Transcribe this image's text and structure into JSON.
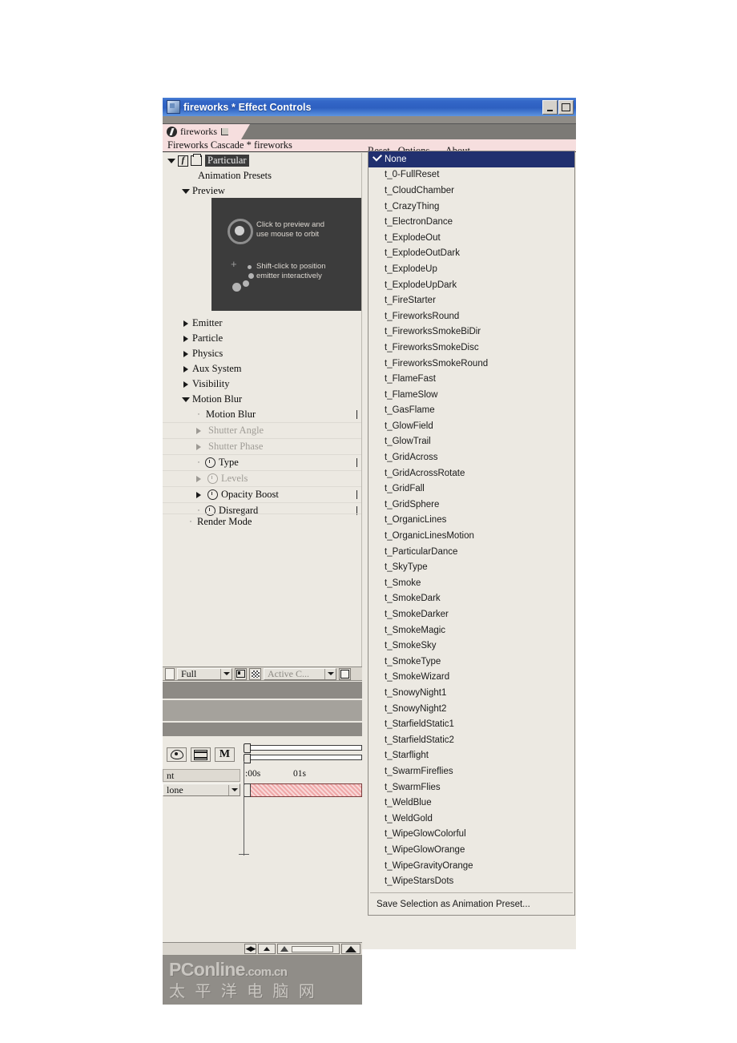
{
  "window": {
    "title": "fireworks * Effect Controls",
    "icon": "composition-icon",
    "minimize_label": "Minimize",
    "maximize_label": "Maximize"
  },
  "tab": {
    "label": "fireworks",
    "icon": "comp-tab-icon",
    "menu_glyph": "panel-menu-icon"
  },
  "comp_header": {
    "text": "Fireworks Cascade * fireworks"
  },
  "effect": {
    "name": "Particular",
    "fx_badge": "fx",
    "cube_icon": "effect-cube-icon",
    "animation_presets_label": "Animation Presets",
    "preview_label": "Preview",
    "preview_box": {
      "line1": "Click to preview and\nuse mouse to orbit",
      "line2": "Shift-click to position\nemitter interactively"
    },
    "groups": [
      {
        "label": "Emitter",
        "state": "closed",
        "indent": 1,
        "disabled": false
      },
      {
        "label": "Particle",
        "state": "closed",
        "indent": 1,
        "disabled": false
      },
      {
        "label": "Physics",
        "state": "closed",
        "indent": 1,
        "disabled": false
      },
      {
        "label": "Aux System",
        "state": "closed",
        "indent": 1,
        "disabled": false
      },
      {
        "label": "Visibility",
        "state": "closed",
        "indent": 1,
        "disabled": false
      },
      {
        "label": "Motion Blur",
        "state": "open",
        "indent": 1,
        "disabled": false
      }
    ],
    "motion_blur_children": [
      {
        "label": "Motion Blur",
        "state": "none",
        "disabled": false,
        "stopwatch": false
      },
      {
        "label": "Shutter Angle",
        "state": "closed",
        "disabled": true,
        "stopwatch": false
      },
      {
        "label": "Shutter Phase",
        "state": "closed",
        "disabled": true,
        "stopwatch": false
      },
      {
        "label": "Type",
        "state": "none",
        "disabled": false,
        "stopwatch": true
      },
      {
        "label": "Levels",
        "state": "closed",
        "disabled": true,
        "stopwatch": true
      },
      {
        "label": "Opacity Boost",
        "state": "closed",
        "disabled": false,
        "stopwatch": true
      },
      {
        "label": "Disregard",
        "state": "none",
        "disabled": false,
        "stopwatch": true
      }
    ],
    "render_mode_label": "Render Mode"
  },
  "ec_toolbar": {
    "quality_value": "Full",
    "toggle_alpha_icon": "region-of-interest-icon",
    "transparency_grid_icon": "transparency-grid-icon",
    "view_value": "Active C...",
    "fullscreen_icon": "full-screen-icon"
  },
  "timeline": {
    "switch_video": "video-switch-icon",
    "switch_frame_blend": "frame-blend-icon",
    "switch_motion_blur": "M",
    "label_value": "nt",
    "parent_value": "lone",
    "ruler": [
      {
        "text": ":00s",
        "x": 2
      },
      {
        "text": "01s",
        "x": 62
      }
    ],
    "clip_color": "#efa8a8"
  },
  "footer": {
    "buttons": [
      "pan-behind-icon",
      "zoom-out-icon",
      "zoom-slider",
      "zoom-in-icon"
    ]
  },
  "watermark": {
    "line1_main": "PConline",
    "line1_suffix": ".com.cn",
    "line2": "太 平 洋 电 脑 网"
  },
  "menu": {
    "commands": [
      "Reset",
      "Options...",
      "About..."
    ],
    "selected_item": "None",
    "items": [
      "t_0-FullReset",
      "t_CloudChamber",
      "t_CrazyThing",
      "t_ElectronDance",
      "t_ExplodeOut",
      "t_ExplodeOutDark",
      "t_ExplodeUp",
      "t_ExplodeUpDark",
      "t_FireStarter",
      "t_FireworksRound",
      "t_FireworksSmokeBiDir",
      "t_FireworksSmokeDisc",
      "t_FireworksSmokeRound",
      "t_FlameFast",
      "t_FlameSlow",
      "t_GasFlame",
      "t_GlowField",
      "t_GlowTrail",
      "t_GridAcross",
      "t_GridAcrossRotate",
      "t_GridFall",
      "t_GridSphere",
      "t_OrganicLines",
      "t_OrganicLinesMotion",
      "t_ParticularDance",
      "t_SkyType",
      "t_Smoke",
      "t_SmokeDark",
      "t_SmokeDarker",
      "t_SmokeMagic",
      "t_SmokeSky",
      "t_SmokeType",
      "t_SmokeWizard",
      "t_SnowyNight1",
      "t_SnowyNight2",
      "t_StarfieldStatic1",
      "t_StarfieldStatic2",
      "t_Starflight",
      "t_SwarmFireflies",
      "t_SwarmFlies",
      "t_WeldBlue",
      "t_WeldGold",
      "t_WipeGlowColorful",
      "t_WipeGlowOrange",
      "t_WipeGravityOrange",
      "t_WipeStarsDots"
    ],
    "save_command": "Save Selection as Animation Preset..."
  },
  "colors": {
    "titlebar_blue": "#2d5fc0",
    "menu_highlight": "#21306f",
    "panel_bg": "#ece9e2",
    "comp_header_pink": "#f6dede",
    "watermark_bg": "#908d88"
  }
}
